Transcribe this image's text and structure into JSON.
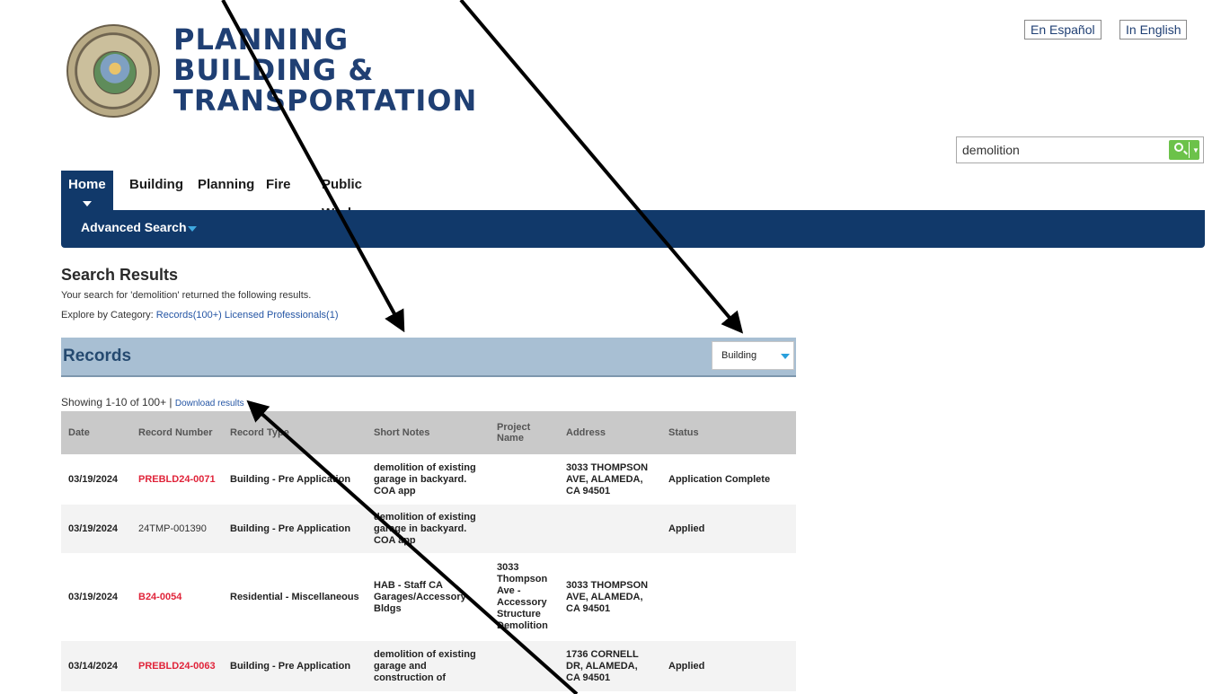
{
  "logo": {
    "line1": "PLANNING",
    "line2": "BUILDING &",
    "line3": "TRANSPORTATION"
  },
  "language": {
    "spanish": "En Español",
    "english": "In English"
  },
  "search": {
    "value": "demolition"
  },
  "nav": {
    "tabs": [
      "Home",
      "Building",
      "Planning",
      "Fire",
      "Public Works"
    ]
  },
  "bar": {
    "advanced_search": "Advanced Search"
  },
  "results": {
    "title": "Search Results",
    "description": "Your search for 'demolition' returned the following results.",
    "explore_label": "Explore by Category:",
    "records_link": "Records(100+)",
    "licensed_link": "Licensed Professionals(1)"
  },
  "records": {
    "title": "Records",
    "filter_value": "Building",
    "showing": "Showing 1-10 of 100+ |",
    "download": "Download results",
    "columns": [
      "Date",
      "Record Number",
      "Record Type",
      "Short Notes",
      "Project Name",
      "Address",
      "Status"
    ],
    "rows": [
      {
        "date": "03/19/2024",
        "number": "PREBLD24-0071",
        "type": "Building - Pre Application",
        "notes": "demolition of existing garage in backyard. COA app",
        "project": "",
        "address": "3033 THOMPSON AVE, ALAMEDA, CA 94501",
        "status": "Application Complete"
      },
      {
        "date": "03/19/2024",
        "number": "24TMP-001390",
        "type": "Building - Pre Application",
        "notes": "demolition of existing garage in backyard. COA app",
        "project": "",
        "address": "",
        "status": "Applied"
      },
      {
        "date": "03/19/2024",
        "number": "B24-0054",
        "type": "Residential - Miscellaneous",
        "notes": "HAB - Staff CA Garages/Accessory Bldgs",
        "project": "3033 Thompson Ave - Accessory Structure Demolition",
        "address": "3033 THOMPSON AVE, ALAMEDA, CA 94501",
        "status": ""
      },
      {
        "date": "03/14/2024",
        "number": "PREBLD24-0063",
        "type": "Building - Pre Application",
        "notes": "demolition of existing garage and construction of",
        "project": "",
        "address": "1736 CORNELL DR, ALAMEDA, CA 94501",
        "status": "Applied"
      }
    ]
  }
}
